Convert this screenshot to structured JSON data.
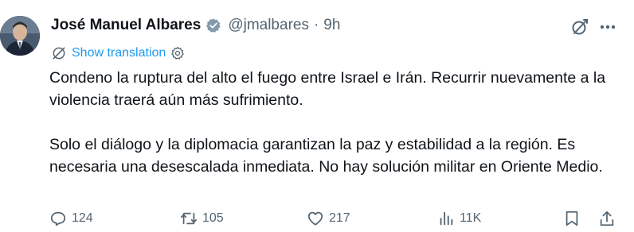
{
  "author": {
    "name": "José Manuel Albares",
    "handle": "@jmalbares",
    "separator": "·",
    "time": "9h"
  },
  "translation": {
    "label": "Show translation"
  },
  "tweet": {
    "paragraphs": [
      "Condeno la ruptura del alto el fuego entre Israel e Irán. Recurrir nuevamente a la violencia traerá aún más sufrimiento.",
      "Solo el diálogo y la diplomacia garantizan la paz y estabilidad a la región. Es necesaria una desescalada inmediata. No hay solución militar en Oriente Medio."
    ]
  },
  "actions": {
    "replies": "124",
    "reposts": "105",
    "likes": "217",
    "views": "11K"
  },
  "colors": {
    "accent": "#1d9bf0",
    "text": "#0f1419",
    "muted": "#536471",
    "verified_badge": "#829aab"
  },
  "icons": {
    "verified": "verified-badge-icon",
    "grok": "grok-icon",
    "more": "more-icon",
    "translate": "translate-icon",
    "settings": "gear-icon",
    "reply": "reply-icon",
    "repost": "repost-icon",
    "like": "heart-icon",
    "views": "views-icon",
    "bookmark": "bookmark-icon",
    "share": "share-icon"
  }
}
